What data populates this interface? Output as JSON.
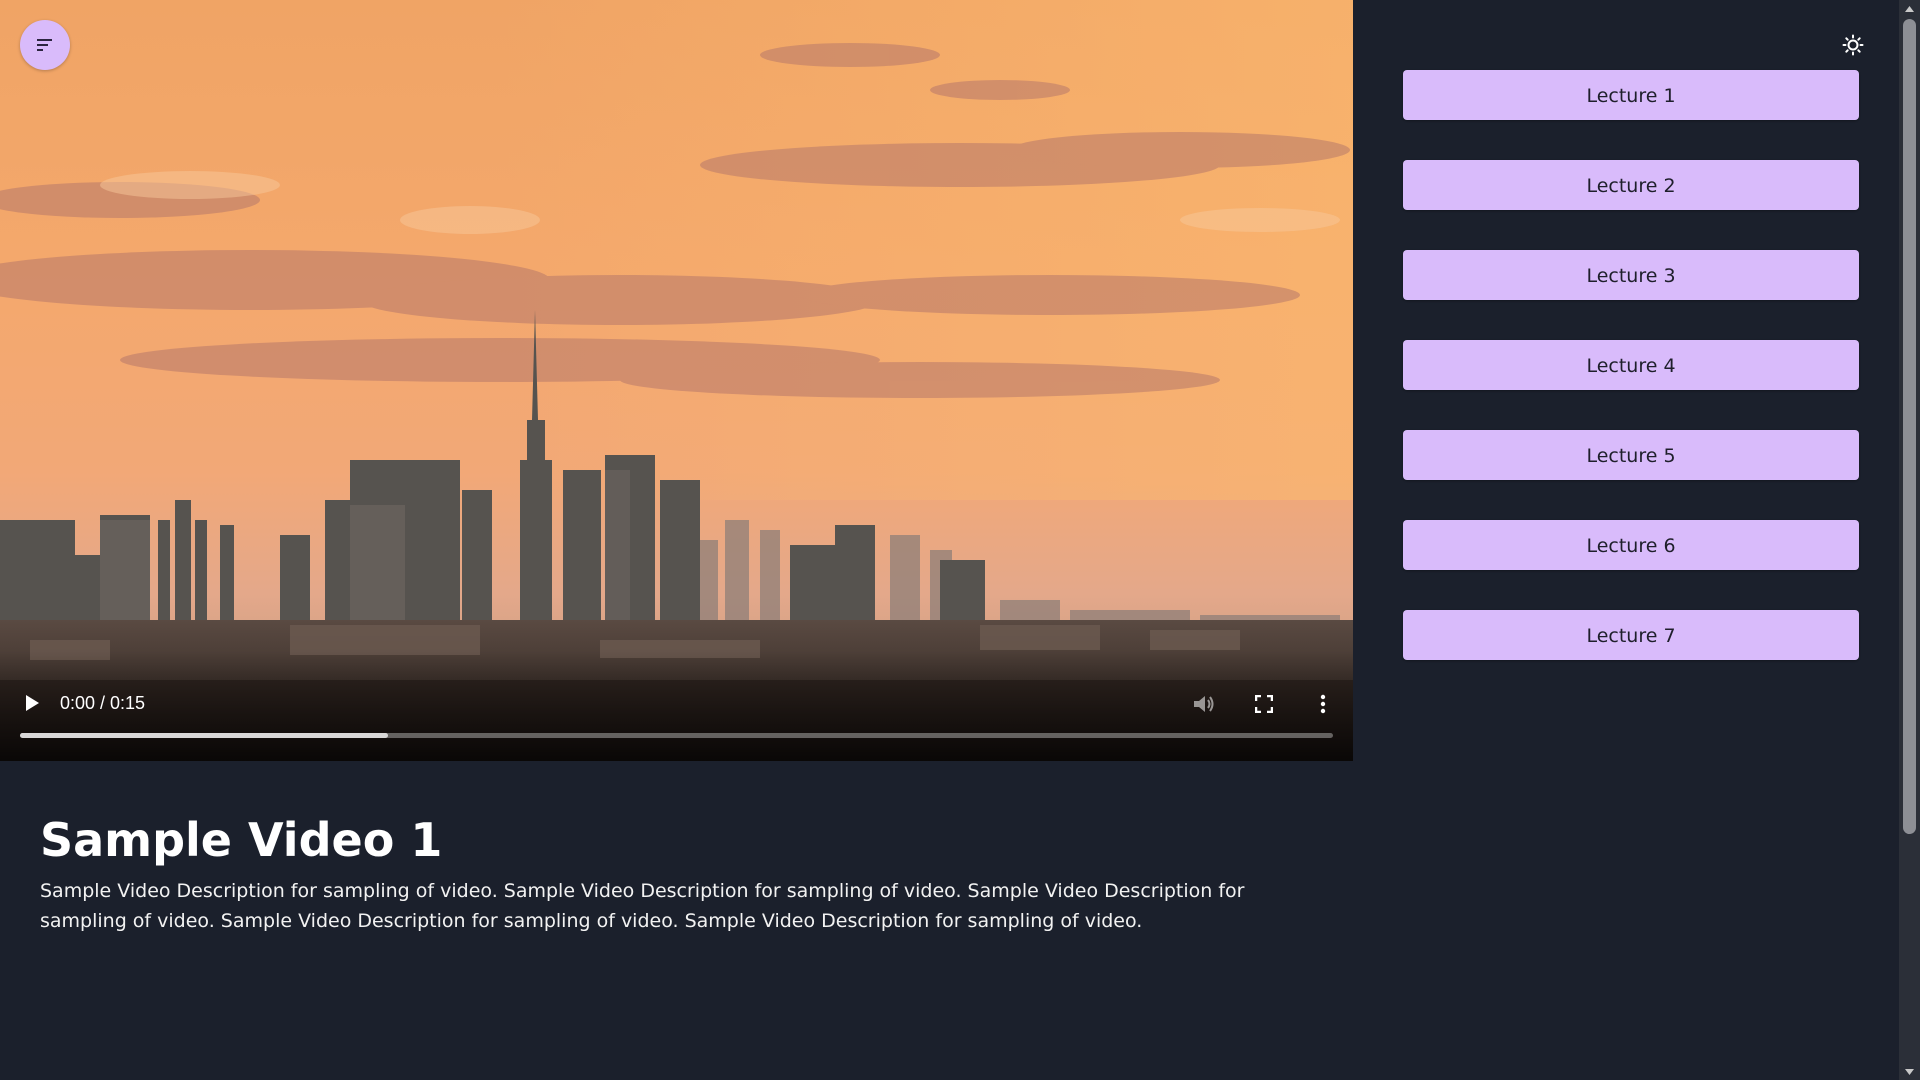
{
  "video": {
    "scene_description_icon": "city-skyline-sunset",
    "time_display": "0:00 / 0:15",
    "buffered_fraction": 0.28,
    "menu_icon": "sort-lines-icon",
    "play_icon": "play-icon",
    "volume_icon": "volume-icon",
    "fullscreen_icon": "fullscreen-icon",
    "more_icon": "more-vertical-icon"
  },
  "info": {
    "title": "Sample Video 1",
    "description": "Sample Video Description for sampling of video. Sample Video Description for sampling of video. Sample Video Description for sampling of video. Sample Video Description for sampling of video. Sample Video Description for sampling of video."
  },
  "sidebar": {
    "theme_icon": "sun-icon",
    "lectures": [
      {
        "label": "Lecture 1"
      },
      {
        "label": "Lecture 2"
      },
      {
        "label": "Lecture 3"
      },
      {
        "label": "Lecture 4"
      },
      {
        "label": "Lecture 5"
      },
      {
        "label": "Lecture 6"
      },
      {
        "label": "Lecture 7"
      }
    ]
  },
  "colors": {
    "background": "#1b202c",
    "accent": "#d9bbfb",
    "text": "#ffffff"
  }
}
